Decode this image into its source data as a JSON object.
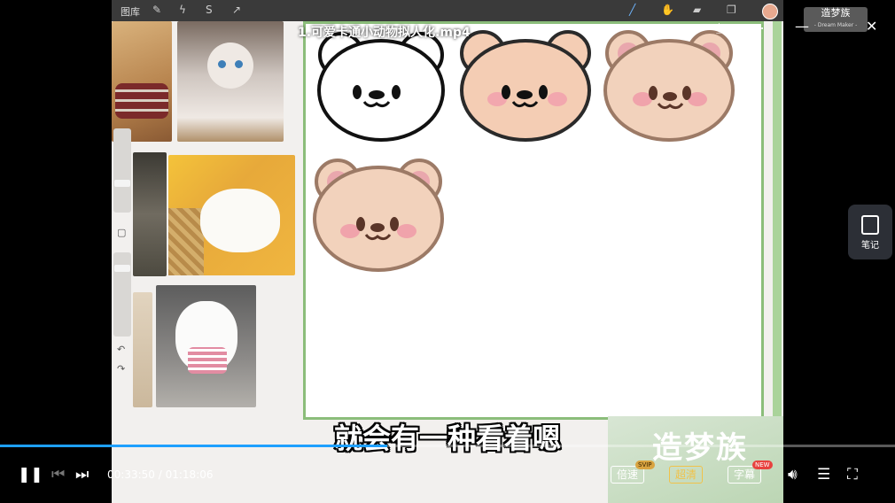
{
  "player": {
    "title": "1.可爱卡通小动物拟人化.mp4",
    "brand": "造梦族",
    "brand_sub": "- Dream Maker -",
    "notes_label": "笔记",
    "subtitle": "就会有一种看着嗯",
    "current_time": "00:33:50",
    "time_separator": "/",
    "duration": "01:18:06",
    "progress": 0.433,
    "speed_label": "倍速",
    "speed_badge": "SVIP",
    "quality_label": "超清",
    "caption_label": "字幕",
    "caption_badge": "NEW",
    "accent_color": "#1ea0ff"
  },
  "procreate": {
    "gallery_label": "图库"
  },
  "watermark": {
    "text": "造梦族"
  },
  "icons": [
    "pause-icon",
    "previous-icon",
    "next-icon",
    "share-icon",
    "download-icon",
    "more-icon",
    "minimize-icon",
    "maximize-icon",
    "close-icon",
    "volume-icon",
    "playlist-icon",
    "fullscreen-icon",
    "notes-icon"
  ]
}
